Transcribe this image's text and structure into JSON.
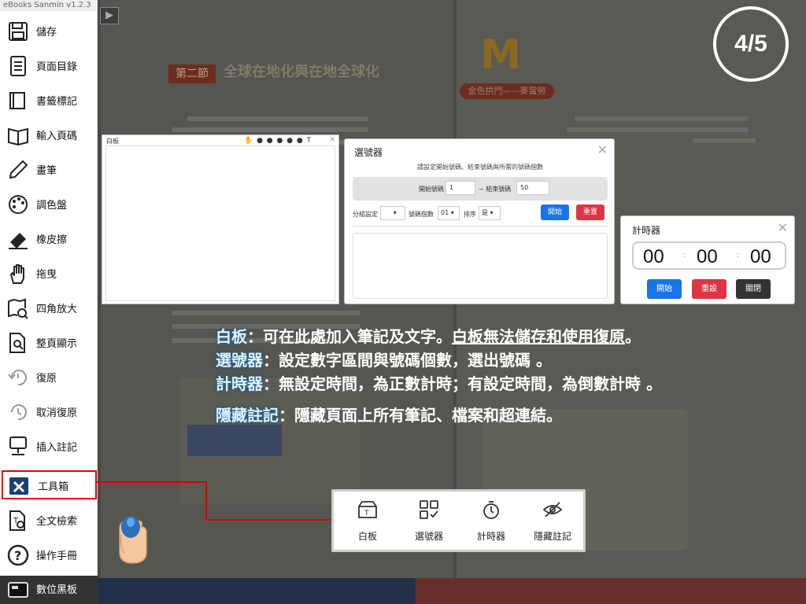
{
  "app": {
    "version": "eBooks Sanmin v1.2.3"
  },
  "page_indicator": "4/5",
  "book": {
    "section_tag": "第二節",
    "section_title": "全球在地化與在地全球化",
    "logo_banner": "金色拱門——麥當勞"
  },
  "sidebar": {
    "items": [
      {
        "label": "儲存",
        "icon": "save-icon"
      },
      {
        "label": "頁面目錄",
        "icon": "page-list-icon"
      },
      {
        "label": "書籤標記",
        "icon": "bookmark-icon"
      },
      {
        "label": "輸入頁碼",
        "icon": "book-open-icon"
      },
      {
        "label": "畫筆",
        "icon": "pen-icon"
      },
      {
        "label": "調色盤",
        "icon": "palette-icon"
      },
      {
        "label": "橡皮擦",
        "icon": "eraser-icon"
      },
      {
        "label": "拖曳",
        "icon": "hand-icon"
      },
      {
        "label": "四角放大",
        "icon": "map-zoom-icon"
      },
      {
        "label": "整頁顯示",
        "icon": "page-search-icon"
      },
      {
        "label": "復原",
        "icon": "undo-icon"
      },
      {
        "label": "取消復原",
        "icon": "redo-icon"
      },
      {
        "label": "插入註記",
        "icon": "note-insert-icon"
      },
      {
        "label": "工具箱",
        "icon": "toolbox-icon"
      },
      {
        "label": "全文檢索",
        "icon": "text-search-icon"
      },
      {
        "label": "操作手冊",
        "icon": "help-icon"
      },
      {
        "label": "數位黑板",
        "icon": "blackboard-icon"
      }
    ]
  },
  "whiteboard": {
    "title": "白板",
    "tools": "✋ ● ● ● ● ● T"
  },
  "selector": {
    "title": "選號器",
    "instruction": "請設定開始號碼、結束號碼與所需的號碼個數",
    "start_label": "開始號碼",
    "start_value": "1",
    "end_label": "~ 結束號碼",
    "end_value": "50",
    "group_label": "分組設定",
    "count_label": "號碼個數",
    "count_value": "01",
    "order_label": "排序",
    "order_value": "是",
    "start_button": "開始",
    "reset_button": "重置"
  },
  "timer": {
    "title": "計時器",
    "hh": "00",
    "mm": "00",
    "ss": "00",
    "start_button": "開始",
    "reset_button": "重設",
    "close_button": "關閉"
  },
  "description": {
    "line1_key": "白板",
    "line1_text": "：可在此處加入筆記及文字。",
    "line1_underlined": "白板無法儲存和使用復原",
    "line1_end": "。",
    "line2_key": "選號器",
    "line2_text": "：設定數字區間與號碼個數，選出號碼 。",
    "line3_key": "計時器",
    "line3_text": "：無設定時間，為正數計時；有設定時間，為倒數計時 。",
    "line4_key": "隱藏註記",
    "line4_text": "：隱藏頁面上所有筆記、檔案和超連結。"
  },
  "toolbox": {
    "items": [
      {
        "label": "白板",
        "icon": "whiteboard-icon"
      },
      {
        "label": "選號器",
        "icon": "selector-icon"
      },
      {
        "label": "計時器",
        "icon": "timer-icon"
      },
      {
        "label": "隱藏註記",
        "icon": "hide-note-icon"
      }
    ]
  },
  "colors": {
    "accent_blue": "#1a73e8",
    "danger_red": "#dc3545",
    "highlight_red": "#dd0000"
  }
}
